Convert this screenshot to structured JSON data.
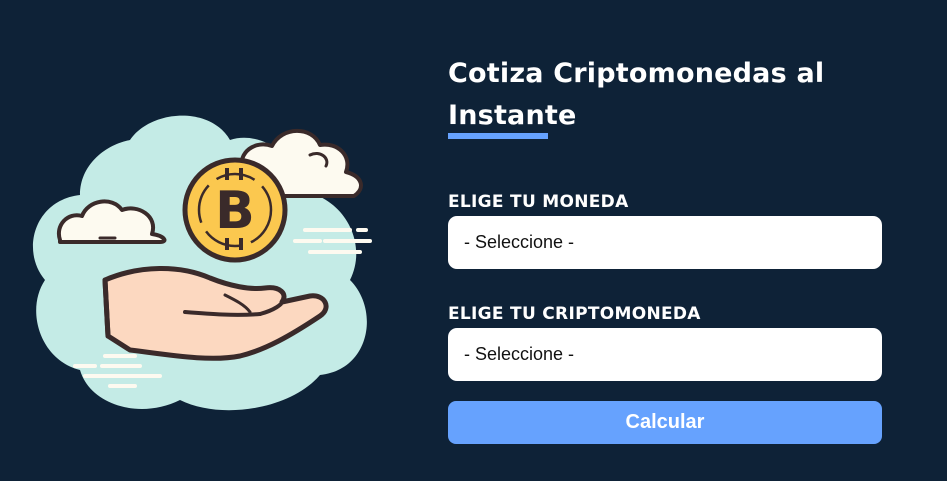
{
  "header": {
    "title_line1": "Cotiza Criptomonedas al",
    "title_line2": "Instante"
  },
  "form": {
    "currency_label": "ELIGE TU MONEDA",
    "currency_value": "- Seleccione -",
    "crypto_label": "ELIGE TU CRIPTOMONEDA",
    "crypto_value": "- Seleccione -",
    "submit_label": "Calcular"
  },
  "illustration": {
    "icon": "hand-holding-bitcoin-icon",
    "coin_symbol": "B"
  },
  "colors": {
    "background": "#0e2237",
    "accent": "#66a2fe",
    "cloud": "#c4ebe6",
    "coin": "#fbc84f"
  }
}
